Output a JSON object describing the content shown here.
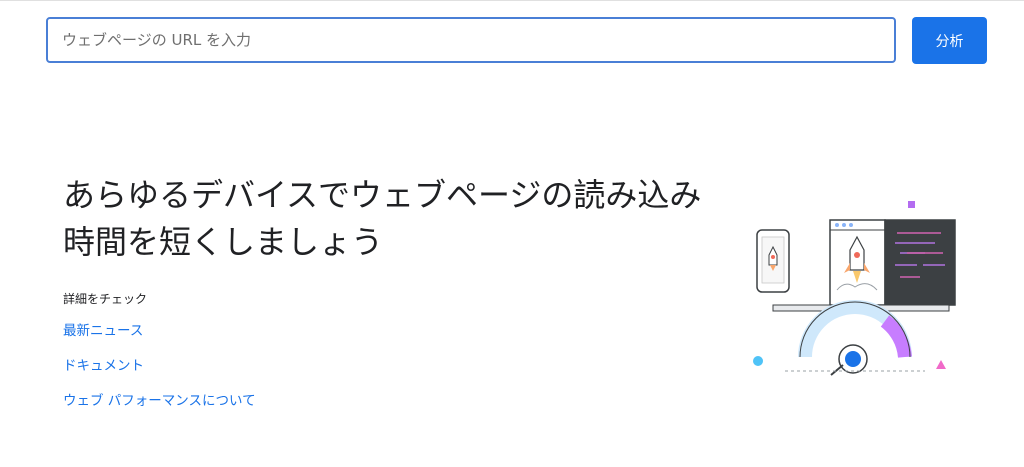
{
  "search": {
    "placeholder": "ウェブページの URL を入力",
    "value": ""
  },
  "analyze_button": {
    "label": "分析"
  },
  "hero": {
    "title": "あらゆるデバイスでウェブページの読み込み時間を短くしましょう"
  },
  "learn_more": {
    "heading": "詳細をチェック",
    "links": [
      {
        "label": "最新ニュース"
      },
      {
        "label": "ドキュメント"
      },
      {
        "label": "ウェブ パフォーマンスについて"
      }
    ]
  },
  "colors": {
    "accent": "#1a73e8",
    "input_border": "#4a7fd6",
    "gauge_purple": "#c77dff",
    "gauge_blue": "#cfe8fb",
    "confetti_pink": "#f06ac8",
    "confetti_purple": "#b36cf0",
    "confetti_cyan": "#4fc3f7"
  },
  "icons": {
    "illustration": "rocket-speed-illustration"
  }
}
